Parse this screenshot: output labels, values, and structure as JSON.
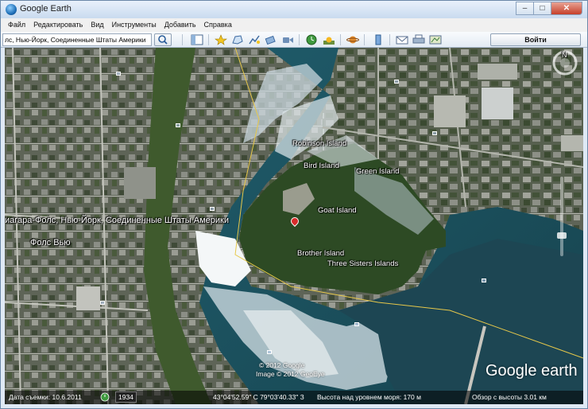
{
  "window": {
    "title": "Google Earth"
  },
  "menu": [
    "Файл",
    "Редактировать",
    "Вид",
    "Инструменты",
    "Добавить",
    "Справка"
  ],
  "search": {
    "value": "лс, Нью-Йорк, Соединенные Штаты Америки"
  },
  "toolbar": {
    "login_label": "Войти",
    "icons": [
      "sidebar-toggle-icon",
      "placemark-icon",
      "polygon-icon",
      "path-icon",
      "image-overlay-icon",
      "record-tour-icon",
      "historical-imagery-icon",
      "sun-icon",
      "planets-icon",
      "ruler-icon",
      "email-icon",
      "print-icon",
      "view-in-maps-icon"
    ]
  },
  "map": {
    "labels": {
      "robinson": "Robinson Island",
      "bird": "Bird Island",
      "green": "Green Island",
      "goat": "Goat Island",
      "brother": "Brother Island",
      "three_sisters": "Three Sisters Islands",
      "falls_view": "Фолс Вью",
      "search_result": "иагара-Фолс, Нью-Йорк, Соединенные Штаты Америки"
    },
    "copyright_line1": "© 2012 Google",
    "copyright_line2": "Image © 2012 GeoEye",
    "logo": "Google earth",
    "compass_north": "N"
  },
  "status": {
    "capture_date": "Дата съемки: 10.6.2011",
    "historical_year": "1934",
    "coords": "43°04'52.59\" С  79°03'40.33\" З",
    "altitude": "Высота над уровнем моря:   170 м",
    "eye_alt": "Обзор с высоты     3.01 км"
  }
}
